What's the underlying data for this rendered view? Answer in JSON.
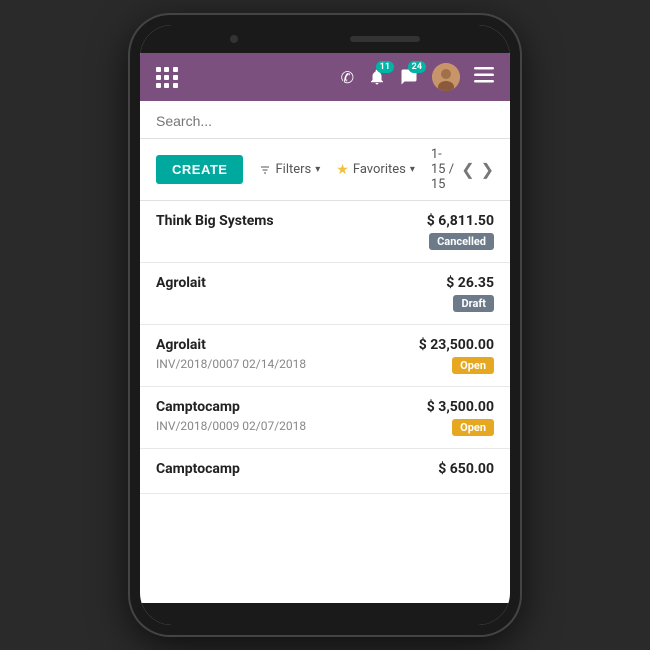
{
  "header": {
    "grid_icon_label": "grid-menu",
    "icons": [
      {
        "name": "phone",
        "symbol": "✆",
        "badge": null
      },
      {
        "name": "bell",
        "symbol": "🔔",
        "badge": "11"
      },
      {
        "name": "chat",
        "symbol": "💬",
        "badge": "24"
      }
    ],
    "menu_label": "☰"
  },
  "search": {
    "placeholder": "Search..."
  },
  "toolbar": {
    "create_label": "CREATE",
    "filter_label": "Filters",
    "favorites_label": "Favorites",
    "pagination_text": "1-15 / 15"
  },
  "items": [
    {
      "name": "Think Big Systems",
      "ref": "",
      "amount": "$ 6,811.50",
      "status": "Cancelled",
      "status_class": "status-cancelled"
    },
    {
      "name": "Agrolait",
      "ref": "",
      "amount": "$ 26.35",
      "status": "Draft",
      "status_class": "status-draft"
    },
    {
      "name": "Agrolait",
      "ref": "INV/2018/0007  02/14/2018",
      "amount": "$ 23,500.00",
      "status": "Open",
      "status_class": "status-open"
    },
    {
      "name": "Camptocamp",
      "ref": "INV/2018/0009  02/07/2018",
      "amount": "$ 3,500.00",
      "status": "Open",
      "status_class": "status-open"
    },
    {
      "name": "Camptocamp",
      "ref": "",
      "amount": "$ 650.00",
      "status": "",
      "status_class": ""
    }
  ]
}
